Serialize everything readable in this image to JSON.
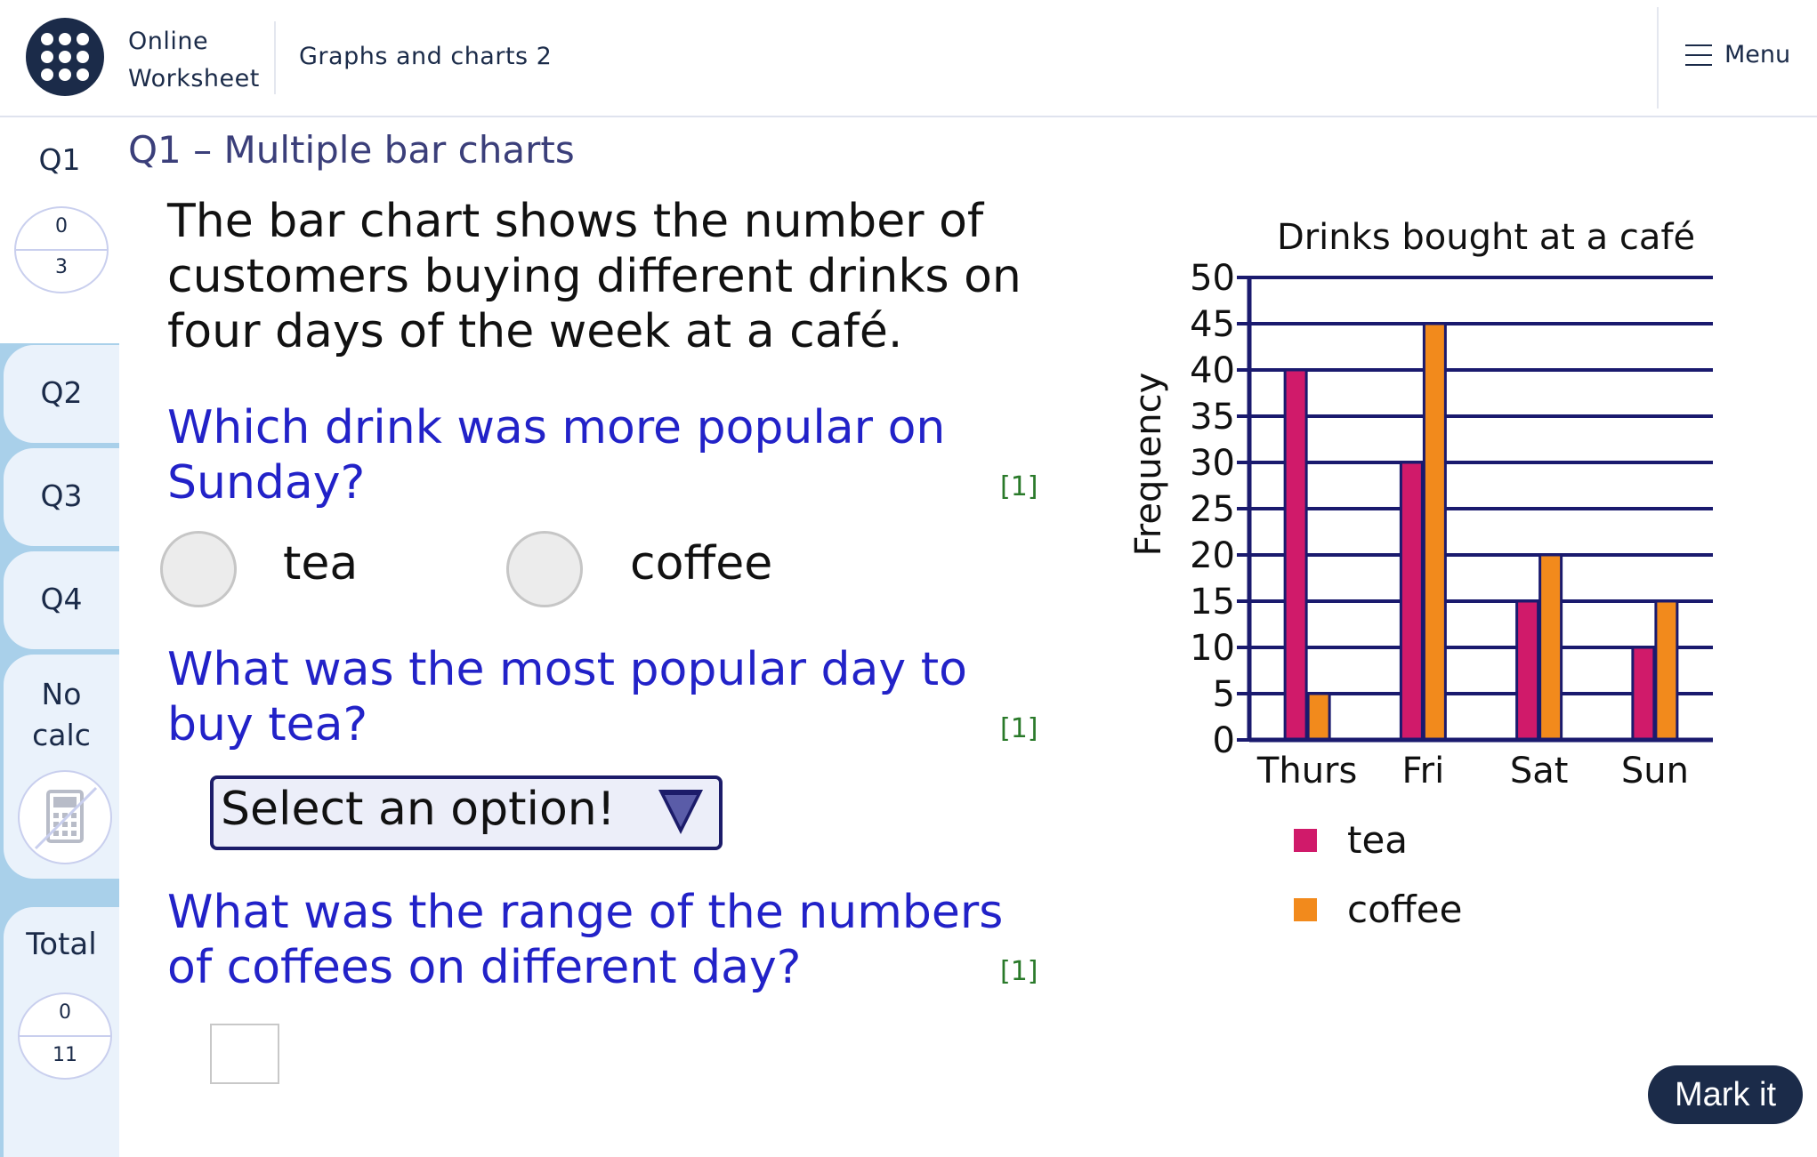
{
  "header": {
    "brand_line1": "Online",
    "brand_line2": "Worksheet",
    "breadcrumb": "Graphs and charts 2",
    "menu_label": "Menu",
    "logo_color": "#1b2b49"
  },
  "sidebar": {
    "q1": {
      "label": "Q1",
      "score": "0",
      "out_of": "3"
    },
    "q2": {
      "label": "Q2"
    },
    "q3": {
      "label": "Q3"
    },
    "q4": {
      "label": "Q4"
    },
    "no_calc": {
      "line1": "No",
      "line2": "calc",
      "icon": "calculator-crossed-icon"
    },
    "total": {
      "label": "Total",
      "score": "0",
      "out_of": "11"
    }
  },
  "question": {
    "title": "Q1 – Multiple bar charts",
    "intro": "The bar chart shows the number of customers buying different drinks on four days of the week at a café.",
    "parts": [
      {
        "text": "Which drink was more popular on Sunday?",
        "marks": "[1]",
        "options": [
          "tea",
          "coffee"
        ]
      },
      {
        "text": "What was the most popular day to buy tea?",
        "marks": "[1]",
        "select_value": "Select an option!"
      },
      {
        "text": "What was the range of the numbers of coffees on different day?",
        "marks": "[1]",
        "input_value": ""
      }
    ]
  },
  "mark_button": "Mark it",
  "chart_data": {
    "type": "bar",
    "title": "Drinks bought at a café",
    "xlabel": "",
    "ylabel": "Frequency",
    "categories": [
      "Thurs",
      "Fri",
      "Sat",
      "Sun"
    ],
    "series": [
      {
        "name": "tea",
        "values": [
          40,
          30,
          15,
          10
        ],
        "color": "#d01a6a"
      },
      {
        "name": "coffee",
        "values": [
          5,
          45,
          20,
          15
        ],
        "color": "#f28a1c"
      }
    ],
    "ylim": [
      0,
      50
    ],
    "yticks": [
      0,
      5,
      10,
      15,
      20,
      25,
      30,
      35,
      40,
      45,
      50
    ],
    "grid": true,
    "legend_position": "bottom",
    "axis_color": "#1a1a6e"
  }
}
